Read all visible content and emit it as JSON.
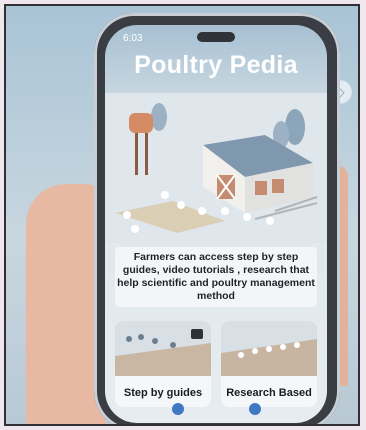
{
  "app": {
    "time": "6:03",
    "title": "Poultry Pedia"
  },
  "intro": {
    "text": "Farmers can access step by step guides, video tutorials , research that help scientific and poultry management method"
  },
  "cards": [
    {
      "label": "Step by guides"
    },
    {
      "label": "Research Based"
    }
  ],
  "icons": {
    "side_nav": "diamond-icon",
    "bottom_left": "pin-icon",
    "bottom_right": "pin-icon"
  }
}
